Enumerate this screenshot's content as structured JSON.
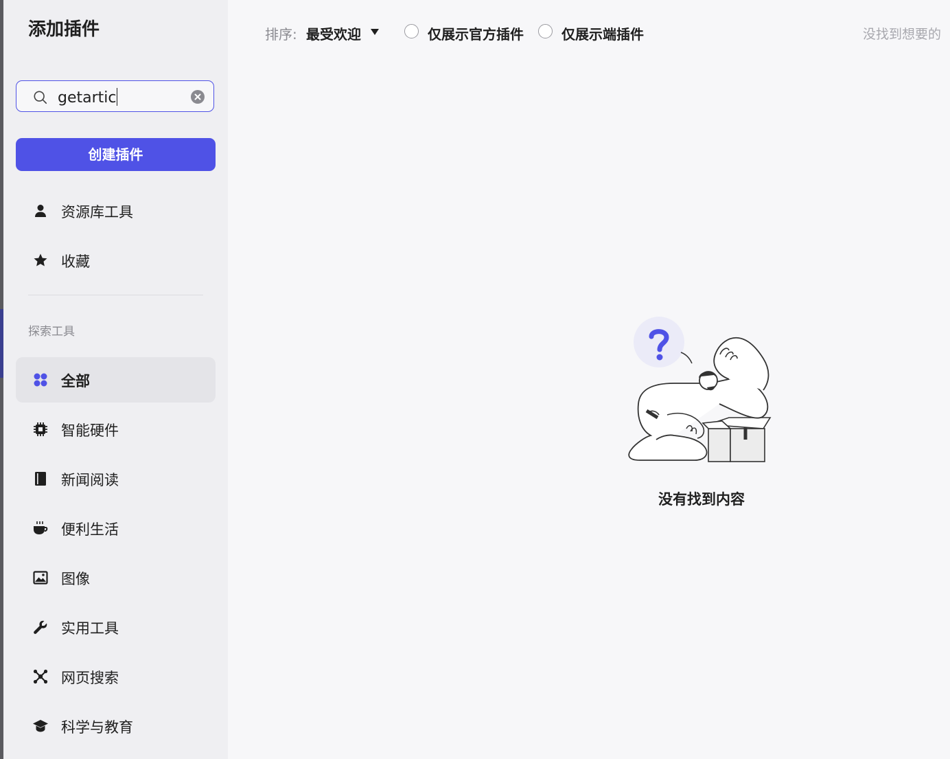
{
  "sidebar": {
    "title": "添加插件",
    "search": {
      "value": "getartic",
      "placeholder": ""
    },
    "create_button": "创建插件",
    "top_items": [
      {
        "label": "资源库工具",
        "icon": "user-icon"
      },
      {
        "label": "收藏",
        "icon": "star-icon"
      }
    ],
    "section_label": "探索工具",
    "categories": [
      {
        "label": "全部",
        "icon": "grid-icon",
        "active": true
      },
      {
        "label": "智能硬件",
        "icon": "chip-icon"
      },
      {
        "label": "新闻阅读",
        "icon": "book-icon"
      },
      {
        "label": "便利生活",
        "icon": "cup-icon"
      },
      {
        "label": "图像",
        "icon": "image-icon"
      },
      {
        "label": "实用工具",
        "icon": "wrench-icon"
      },
      {
        "label": "网页搜索",
        "icon": "network-icon"
      },
      {
        "label": "科学与教育",
        "icon": "graduation-cap-icon"
      }
    ]
  },
  "toolbar": {
    "sort_label": "排序:",
    "sort_value": "最受欢迎",
    "filter_official": "仅展示官方插件",
    "filter_device": "仅展示端插件",
    "hint": "没找到想要的"
  },
  "empty_state": {
    "text": "没有找到内容"
  },
  "colors": {
    "accent": "#4f52e6",
    "sidebar_bg": "#efeff2",
    "main_bg": "#f7f7f9"
  }
}
